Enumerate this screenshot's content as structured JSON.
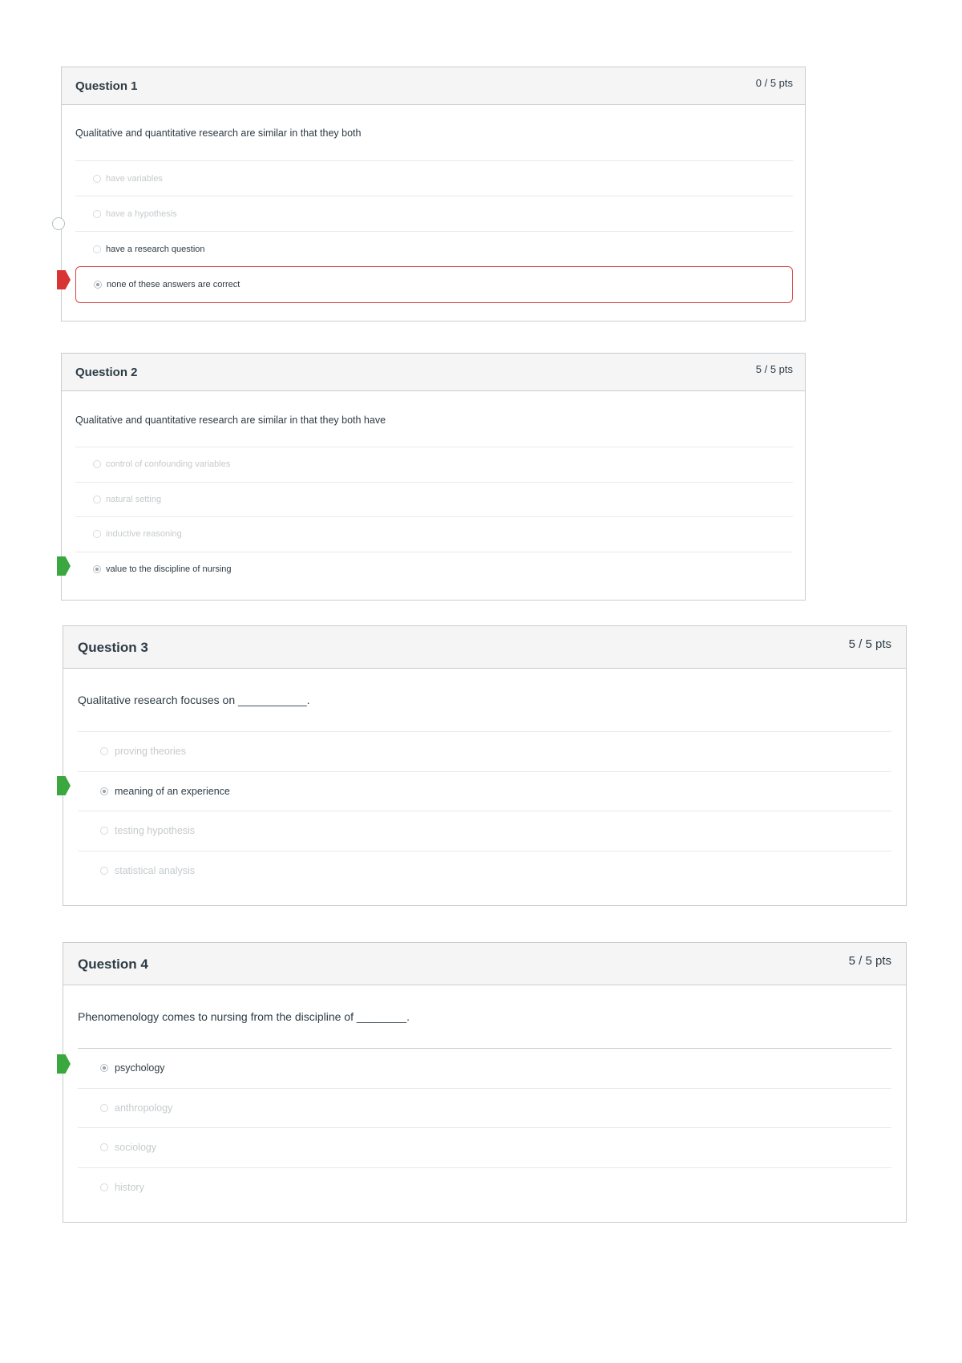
{
  "questions": [
    {
      "title": "Question 1",
      "points": "0 / 5 pts",
      "prompt": "Qualitative and quantitative research are similar in that they both",
      "answers": [
        {
          "text": "have variables",
          "selected": false
        },
        {
          "text": "have a hypothesis",
          "selected": false
        },
        {
          "text": "have a research question",
          "selected": false,
          "marker": "correct-answer"
        },
        {
          "text": "none of these answers are correct",
          "selected": true,
          "marker": "incorrect"
        }
      ]
    },
    {
      "title": "Question 2",
      "points": "5 / 5 pts",
      "prompt": "Qualitative and quantitative research are similar in that they both have",
      "answers": [
        {
          "text": "control of confounding variables",
          "selected": false
        },
        {
          "text": "natural setting",
          "selected": false
        },
        {
          "text": "inductive reasoning",
          "selected": false
        },
        {
          "text": "value to the discipline of nursing",
          "selected": true,
          "marker": "correct"
        }
      ]
    },
    {
      "title": "Question 3",
      "points": "5 / 5 pts",
      "prompt": "Qualitative research focuses on ___________.",
      "answers": [
        {
          "text": "proving theories",
          "selected": false
        },
        {
          "text": "meaning of an experience",
          "selected": true,
          "marker": "correct"
        },
        {
          "text": "testing hypothesis",
          "selected": false
        },
        {
          "text": "statistical analysis",
          "selected": false
        }
      ]
    },
    {
      "title": "Question 4",
      "points": "5 / 5 pts",
      "prompt": "Phenomenology comes to nursing from the discipline of ________.",
      "answers": [
        {
          "text": "psychology",
          "selected": true,
          "marker": "correct"
        },
        {
          "text": "anthropology",
          "selected": false
        },
        {
          "text": "sociology",
          "selected": false
        },
        {
          "text": "history",
          "selected": false
        }
      ]
    }
  ],
  "colors": {
    "correct_marker": "#3ba73f",
    "incorrect_marker": "#d93434",
    "incorrect_border": "#d64545",
    "header_bg": "#f5f5f5",
    "border": "#c7cdd1"
  }
}
